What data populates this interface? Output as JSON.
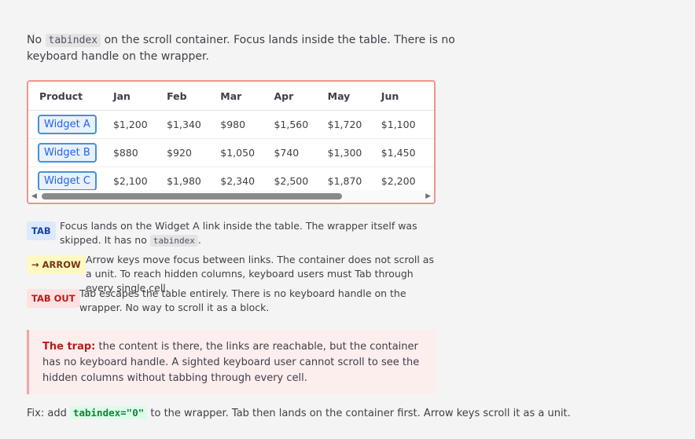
{
  "intro": {
    "pre": "No ",
    "code": "tabindex",
    "post": " on the scroll container. Focus lands inside the table. There is no keyboard handle on the wrapper."
  },
  "table": {
    "headers": [
      "Product",
      "Jan",
      "Feb",
      "Mar",
      "Apr",
      "May",
      "Jun"
    ],
    "rows": [
      {
        "product": "Widget A",
        "values": [
          "$1,200",
          "$1,340",
          "$980",
          "$1,560",
          "$1,720",
          "$1,100"
        ]
      },
      {
        "product": "Widget B",
        "values": [
          "$880",
          "$920",
          "$1,050",
          "$740",
          "$1,300",
          "$1,450"
        ]
      },
      {
        "product": "Widget C",
        "values": [
          "$2,100",
          "$1,980",
          "$2,340",
          "$2,500",
          "$1,870",
          "$2,200"
        ]
      }
    ],
    "scroll_left_icon": "caret-left-icon",
    "scroll_right_icon": "caret-right-icon"
  },
  "steps": [
    {
      "badge": "TAB",
      "text_pre": "Focus lands on the Widget A link inside the table. The wrapper itself was skipped. It has no ",
      "code": "tabindex",
      "text_post": "."
    },
    {
      "badge": "→ ARROW",
      "text": "Arrow keys move focus between links. The container does not scroll as a unit. To reach hidden columns, keyboard users must Tab through every single cell."
    },
    {
      "badge": "TAB OUT",
      "text": "Tab escapes the table entirely. There is no keyboard handle on the wrapper. No way to scroll it as a block."
    }
  ],
  "trap": {
    "label": "The trap:",
    "text": " the content is there, the links are reachable, but the container has no keyboard handle. A sighted keyboard user cannot scroll to see the hidden columns without tabbing through every cell."
  },
  "fix": {
    "pre": "Fix: add ",
    "code": "tabindex=\"0\"",
    "post": " to the wrapper. Tab then lands on the container first. Arrow keys scroll it as a unit."
  }
}
